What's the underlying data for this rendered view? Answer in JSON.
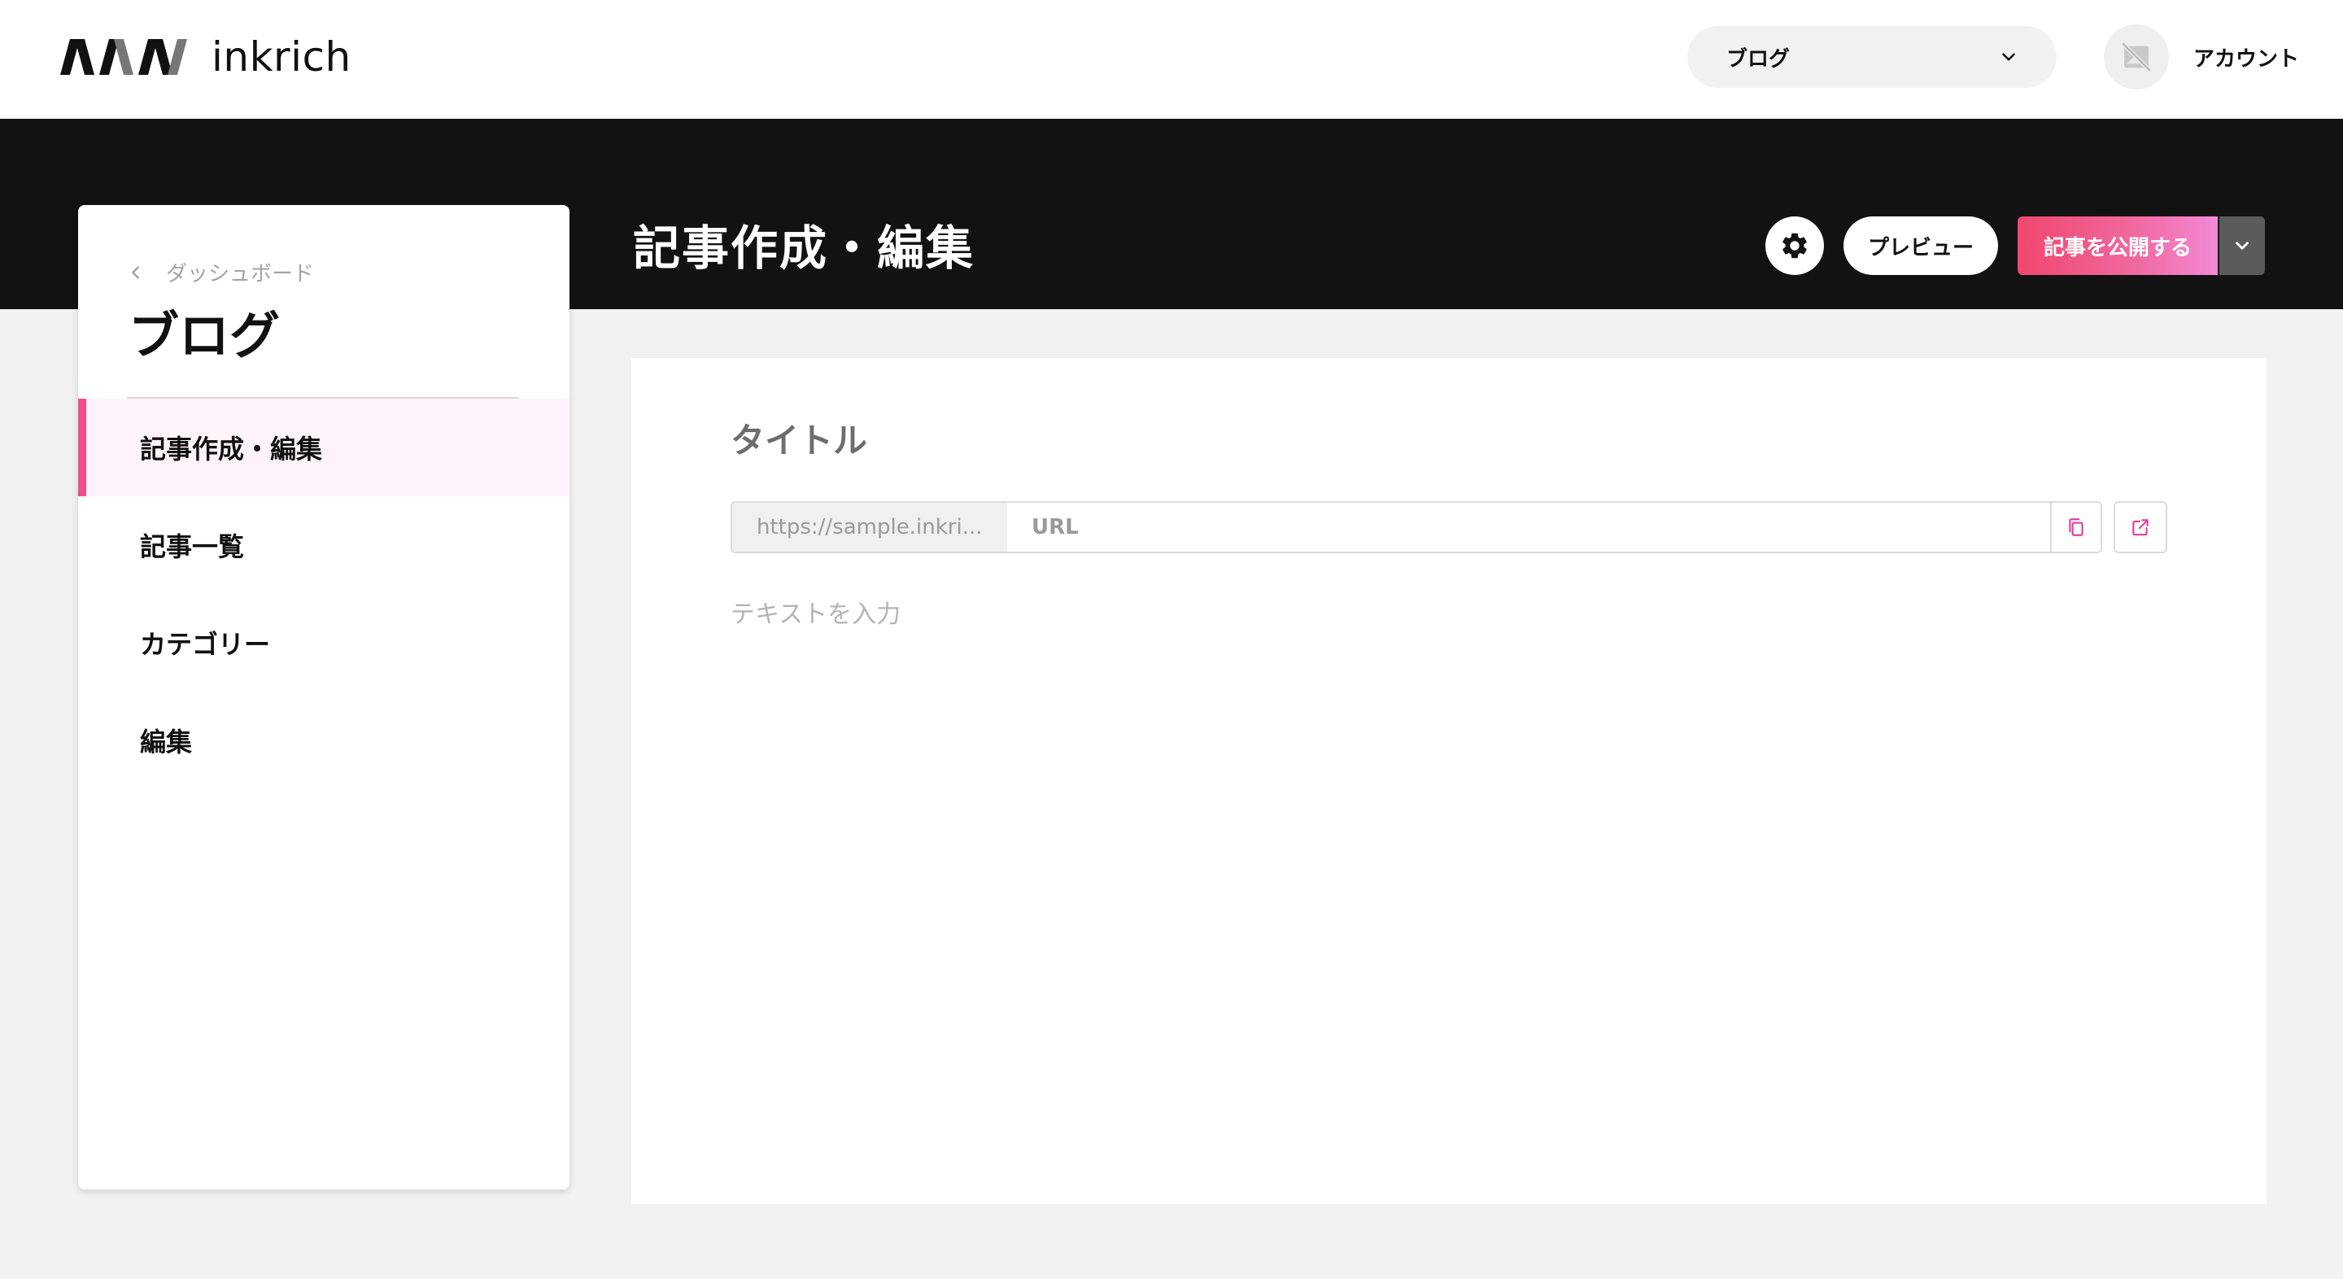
{
  "header": {
    "logo_text": "inkrich",
    "site_select": {
      "value": "ブログ",
      "icon": "chevron-down-icon"
    },
    "account": {
      "label": "アカウント",
      "avatar_icon": "no-image-icon"
    }
  },
  "band": {
    "page_title": "記事作成・編集",
    "actions": {
      "settings_icon": "gear-icon",
      "preview_label": "プレビュー",
      "publish_label": "記事を公開する",
      "publish_menu_icon": "chevron-down-icon"
    }
  },
  "sidebar": {
    "back_label": "ダッシュボード",
    "title": "ブログ",
    "items": [
      {
        "label": "記事作成・編集",
        "active": true
      },
      {
        "label": "記事一覧",
        "active": false
      },
      {
        "label": "カテゴリー",
        "active": false
      },
      {
        "label": "編集",
        "active": false
      }
    ]
  },
  "editor": {
    "title_placeholder": "タイトル",
    "url_prefix": "https://sample.inkri...",
    "url_placeholder": "URL",
    "body_placeholder": "テキストを入力",
    "copy_icon": "copy-icon",
    "open_icon": "external-link-icon"
  },
  "colors": {
    "accent": "#ee4f88",
    "band": "#121212",
    "background": "#f2f2f2",
    "publish_gradient": [
      "#f0466e",
      "#f38ad8"
    ]
  }
}
